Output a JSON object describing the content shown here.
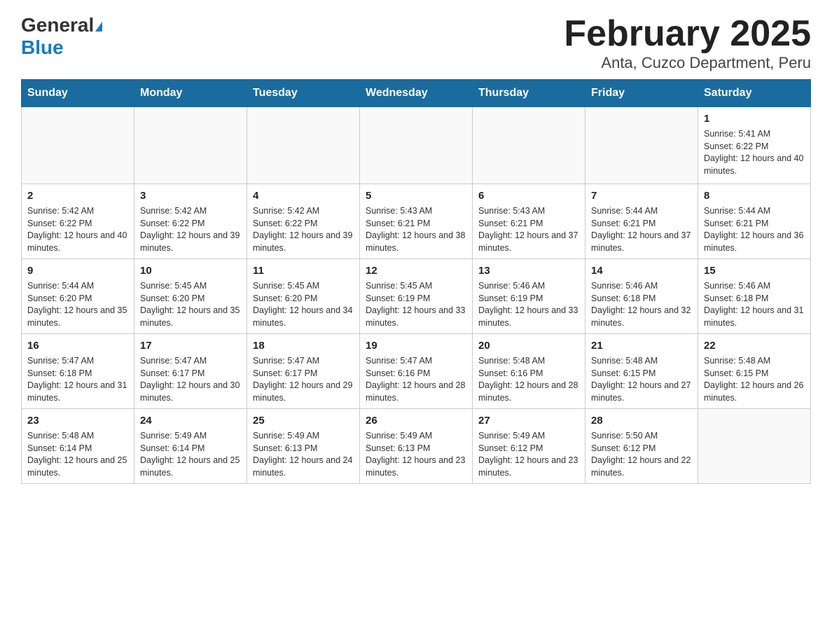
{
  "logo": {
    "general": "General",
    "blue": "Blue"
  },
  "title": "February 2025",
  "subtitle": "Anta, Cuzco Department, Peru",
  "days_of_week": [
    "Sunday",
    "Monday",
    "Tuesday",
    "Wednesday",
    "Thursday",
    "Friday",
    "Saturday"
  ],
  "weeks": [
    [
      {
        "day": "",
        "info": ""
      },
      {
        "day": "",
        "info": ""
      },
      {
        "day": "",
        "info": ""
      },
      {
        "day": "",
        "info": ""
      },
      {
        "day": "",
        "info": ""
      },
      {
        "day": "",
        "info": ""
      },
      {
        "day": "1",
        "info": "Sunrise: 5:41 AM\nSunset: 6:22 PM\nDaylight: 12 hours and 40 minutes."
      }
    ],
    [
      {
        "day": "2",
        "info": "Sunrise: 5:42 AM\nSunset: 6:22 PM\nDaylight: 12 hours and 40 minutes."
      },
      {
        "day": "3",
        "info": "Sunrise: 5:42 AM\nSunset: 6:22 PM\nDaylight: 12 hours and 39 minutes."
      },
      {
        "day": "4",
        "info": "Sunrise: 5:42 AM\nSunset: 6:22 PM\nDaylight: 12 hours and 39 minutes."
      },
      {
        "day": "5",
        "info": "Sunrise: 5:43 AM\nSunset: 6:21 PM\nDaylight: 12 hours and 38 minutes."
      },
      {
        "day": "6",
        "info": "Sunrise: 5:43 AM\nSunset: 6:21 PM\nDaylight: 12 hours and 37 minutes."
      },
      {
        "day": "7",
        "info": "Sunrise: 5:44 AM\nSunset: 6:21 PM\nDaylight: 12 hours and 37 minutes."
      },
      {
        "day": "8",
        "info": "Sunrise: 5:44 AM\nSunset: 6:21 PM\nDaylight: 12 hours and 36 minutes."
      }
    ],
    [
      {
        "day": "9",
        "info": "Sunrise: 5:44 AM\nSunset: 6:20 PM\nDaylight: 12 hours and 35 minutes."
      },
      {
        "day": "10",
        "info": "Sunrise: 5:45 AM\nSunset: 6:20 PM\nDaylight: 12 hours and 35 minutes."
      },
      {
        "day": "11",
        "info": "Sunrise: 5:45 AM\nSunset: 6:20 PM\nDaylight: 12 hours and 34 minutes."
      },
      {
        "day": "12",
        "info": "Sunrise: 5:45 AM\nSunset: 6:19 PM\nDaylight: 12 hours and 33 minutes."
      },
      {
        "day": "13",
        "info": "Sunrise: 5:46 AM\nSunset: 6:19 PM\nDaylight: 12 hours and 33 minutes."
      },
      {
        "day": "14",
        "info": "Sunrise: 5:46 AM\nSunset: 6:18 PM\nDaylight: 12 hours and 32 minutes."
      },
      {
        "day": "15",
        "info": "Sunrise: 5:46 AM\nSunset: 6:18 PM\nDaylight: 12 hours and 31 minutes."
      }
    ],
    [
      {
        "day": "16",
        "info": "Sunrise: 5:47 AM\nSunset: 6:18 PM\nDaylight: 12 hours and 31 minutes."
      },
      {
        "day": "17",
        "info": "Sunrise: 5:47 AM\nSunset: 6:17 PM\nDaylight: 12 hours and 30 minutes."
      },
      {
        "day": "18",
        "info": "Sunrise: 5:47 AM\nSunset: 6:17 PM\nDaylight: 12 hours and 29 minutes."
      },
      {
        "day": "19",
        "info": "Sunrise: 5:47 AM\nSunset: 6:16 PM\nDaylight: 12 hours and 28 minutes."
      },
      {
        "day": "20",
        "info": "Sunrise: 5:48 AM\nSunset: 6:16 PM\nDaylight: 12 hours and 28 minutes."
      },
      {
        "day": "21",
        "info": "Sunrise: 5:48 AM\nSunset: 6:15 PM\nDaylight: 12 hours and 27 minutes."
      },
      {
        "day": "22",
        "info": "Sunrise: 5:48 AM\nSunset: 6:15 PM\nDaylight: 12 hours and 26 minutes."
      }
    ],
    [
      {
        "day": "23",
        "info": "Sunrise: 5:48 AM\nSunset: 6:14 PM\nDaylight: 12 hours and 25 minutes."
      },
      {
        "day": "24",
        "info": "Sunrise: 5:49 AM\nSunset: 6:14 PM\nDaylight: 12 hours and 25 minutes."
      },
      {
        "day": "25",
        "info": "Sunrise: 5:49 AM\nSunset: 6:13 PM\nDaylight: 12 hours and 24 minutes."
      },
      {
        "day": "26",
        "info": "Sunrise: 5:49 AM\nSunset: 6:13 PM\nDaylight: 12 hours and 23 minutes."
      },
      {
        "day": "27",
        "info": "Sunrise: 5:49 AM\nSunset: 6:12 PM\nDaylight: 12 hours and 23 minutes."
      },
      {
        "day": "28",
        "info": "Sunrise: 5:50 AM\nSunset: 6:12 PM\nDaylight: 12 hours and 22 minutes."
      },
      {
        "day": "",
        "info": ""
      }
    ]
  ]
}
